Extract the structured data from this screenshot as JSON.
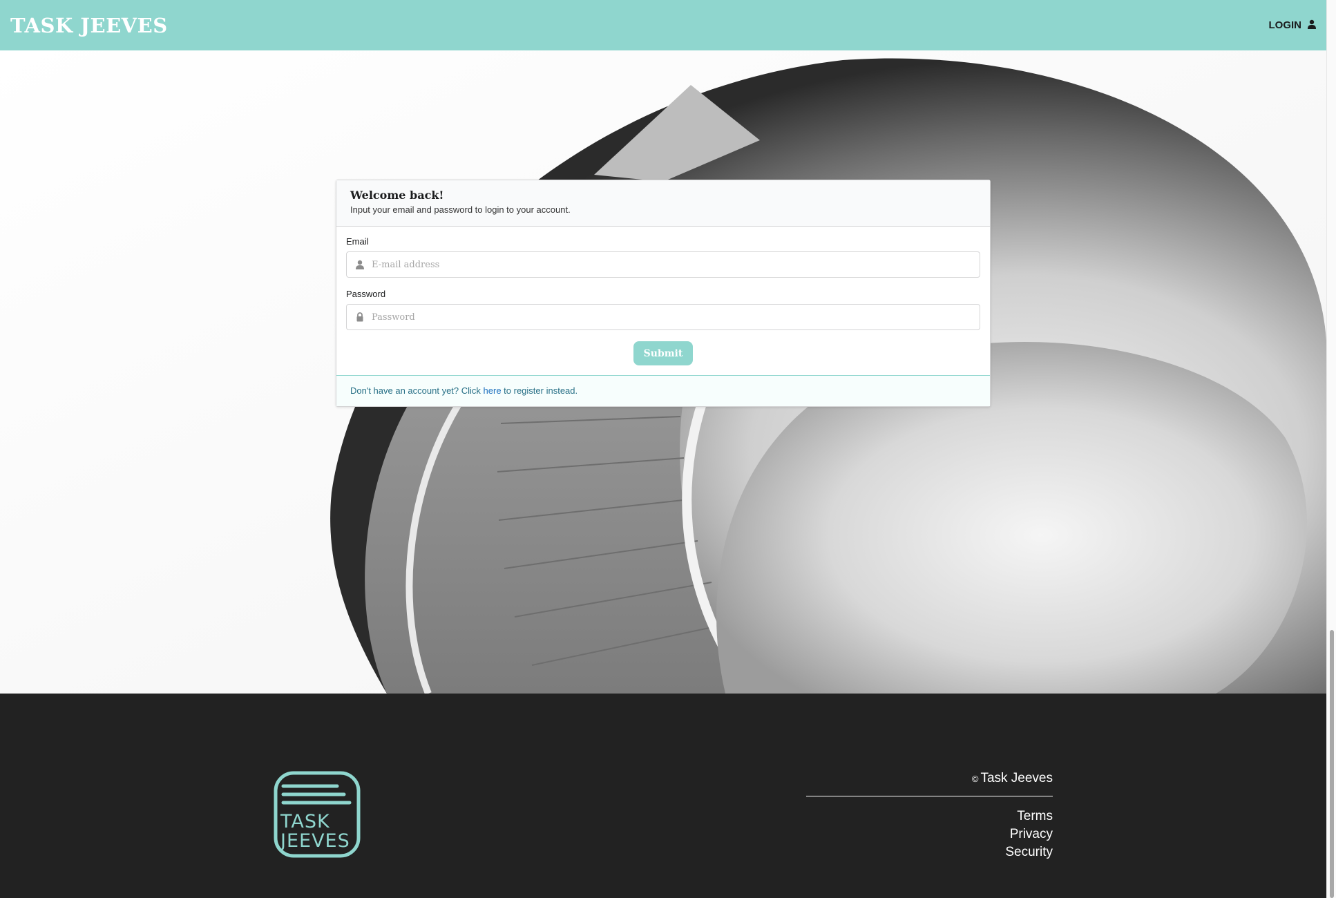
{
  "header": {
    "brand": "TASK JEEVES",
    "login_label": "LOGIN"
  },
  "login_card": {
    "title": "Welcome back!",
    "subtitle": "Input your email and password to login to your account.",
    "email_label": "Email",
    "email_placeholder": "E-mail address",
    "email_value": "",
    "password_label": "Password",
    "password_placeholder": "Password",
    "password_value": "",
    "submit_label": "Submit",
    "footer_prefix": "Don't have an account yet? Click ",
    "footer_link": "here",
    "footer_suffix": " to register instead."
  },
  "footer": {
    "copyright_symbol": "©",
    "copyright_text": "Task Jeeves",
    "logo_line1": "TASK",
    "logo_line2": "JEEVES",
    "links": [
      "Terms",
      "Privacy",
      "Security"
    ]
  },
  "colors": {
    "accent": "#8fd6ce",
    "footer_bg": "#222222",
    "link": "#1e70bf"
  },
  "icons": {
    "login": "user-icon",
    "email": "user-icon",
    "password": "lock-icon"
  }
}
